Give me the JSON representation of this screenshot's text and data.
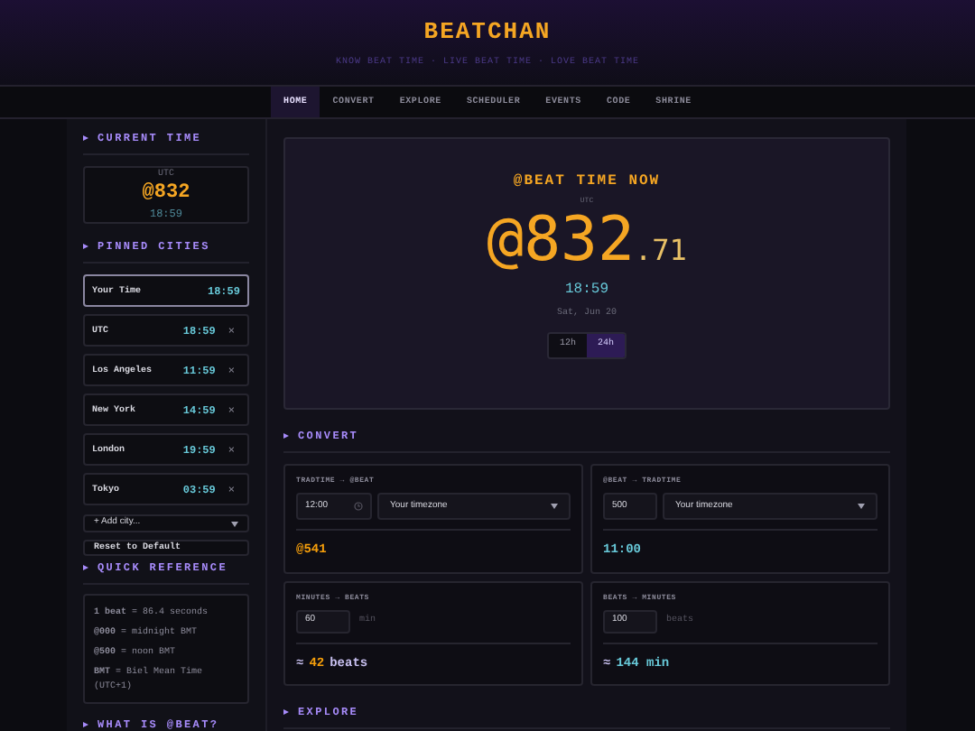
{
  "header": {
    "title": "BEATCHAN",
    "tagline": "KNOW BEAT TIME · LIVE BEAT TIME · LOVE BEAT TIME"
  },
  "nav": [
    {
      "label": "HOME",
      "selected": true
    },
    {
      "label": "CONVERT",
      "selected": false
    },
    {
      "label": "EXPLORE",
      "selected": false
    },
    {
      "label": "SCHEDULER",
      "selected": false
    },
    {
      "label": "EVENTS",
      "selected": false
    },
    {
      "label": "CODE",
      "selected": false
    },
    {
      "label": "SHRINE",
      "selected": false
    }
  ],
  "sidebar": {
    "current_time": {
      "heading": "CURRENT TIME",
      "zone": "UTC",
      "beat": "@832",
      "time": "18:59"
    },
    "pinned": {
      "heading": "PINNED CITIES",
      "cities": [
        {
          "name": "Your Time",
          "time": "18:59",
          "selected": true
        },
        {
          "name": "UTC",
          "time": "18:59",
          "selected": false,
          "remove": "×"
        },
        {
          "name": "Los Angeles",
          "time": "11:59",
          "selected": false,
          "remove": "×"
        },
        {
          "name": "New York",
          "time": "14:59",
          "selected": false,
          "remove": "×"
        },
        {
          "name": "London",
          "time": "19:59",
          "selected": false,
          "remove": "×"
        },
        {
          "name": "Tokyo",
          "time": "03:59",
          "selected": false,
          "remove": "×"
        }
      ],
      "add_city": "+ Add city...",
      "reset_button": "Reset to Default"
    },
    "quick_reference": {
      "heading": "QUICK REFERENCE",
      "lines": [
        "**1 beat** = 86.4 seconds",
        "**@000** = midnight BMT",
        "**@500** = noon BMT",
        "**BMT** = Biel Mean Time (UTC+1)"
      ]
    },
    "what_is": {
      "heading": "WHAT IS @BEAT?"
    }
  },
  "hero": {
    "title": "@BEAT TIME NOW",
    "zone": "UTC",
    "beat": "@832",
    "fraction": ".71",
    "time": "18:59",
    "date": "Sat, Jun 20",
    "format_toggle": [
      {
        "label": "12h",
        "selected": false
      },
      {
        "label": "24h",
        "selected": true
      }
    ]
  },
  "convert": {
    "heading": "CONVERT",
    "cards": [
      {
        "kind": "time",
        "label": "TRADTIME → @BEAT",
        "input": "12:00",
        "select": "Your timezone",
        "result": "@541",
        "color": "#f59e0b"
      },
      {
        "kind": "select",
        "label": "@BEAT → TRADTIME",
        "input": "500",
        "select": "Your timezone",
        "result": "11:00",
        "color": "#67c8d8"
      },
      {
        "kind": "unit",
        "label": "MINUTES → BEATS",
        "input": "60",
        "unit": "min",
        "approx": "≈",
        "result": "42",
        "result_unit": "beats",
        "color": "#f59e0b"
      },
      {
        "kind": "unit",
        "label": "BEATS → MINUTES",
        "input": "100",
        "unit": "beats",
        "approx": "≈",
        "result": "144 min",
        "color": "#67c8d8"
      }
    ]
  },
  "explore": {
    "heading": "EXPLORE"
  }
}
